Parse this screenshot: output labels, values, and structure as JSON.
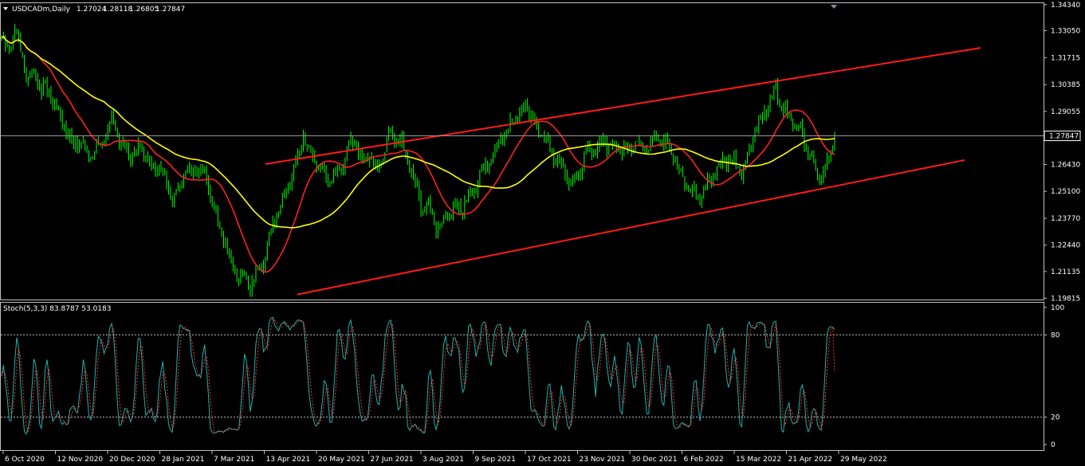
{
  "symbol_header": "USDCADm,Daily",
  "ohlc": {
    "open": "1.27024",
    "high": "1.28118",
    "low": "1.26805",
    "close": "1.27847"
  },
  "indicator_header": "Stoch(5,3,3) 83.8787 53.0183",
  "current_price": "1.27847",
  "chart_data": {
    "type": "candlestick",
    "price_ticks": [
      "1.34340",
      "1.33050",
      "1.31715",
      "1.30385",
      "1.29055",
      "1.27847",
      "1.26430",
      "1.25100",
      "1.23770",
      "1.22440",
      "1.21135",
      "1.19815"
    ],
    "ylim": [
      1.1975,
      1.3445
    ],
    "date_labels": [
      "6 Oct 2020",
      "12 Nov 2020",
      "20 Dec 2020",
      "28 Jan 2021",
      "7 Mar 2021",
      "13 Apr 2021",
      "20 May 2021",
      "27 Jun 2021",
      "3 Aug 2021",
      "9 Sep 2021",
      "17 Oct 2021",
      "23 Nov 2021",
      "30 Dec 2021",
      "6 Feb 2022",
      "15 Mar 2022",
      "21 Apr 2022",
      "29 May 2022"
    ],
    "price_anchors": [
      [
        1.327,
        1.3215,
        1.3305,
        1.32,
        1.306,
        1.311,
        1.301,
        1.302,
        1.294,
        1.287,
        1.28,
        1.274,
        1.277,
        1.268,
        1.27,
        1.274,
        1.282
      ],
      [
        1.286,
        1.276,
        1.271,
        1.269,
        1.273,
        1.267,
        1.261,
        1.265,
        1.256,
        1.247,
        1.252,
        1.261,
        1.259,
        1.264,
        1.259,
        1.248,
        1.236
      ],
      [
        1.226,
        1.215,
        1.21,
        1.208,
        1.206,
        1.211,
        1.217,
        1.23,
        1.24,
        1.248,
        1.259,
        1.266,
        1.278,
        1.27,
        1.264,
        1.26,
        1.256
      ],
      [
        1.258,
        1.264,
        1.274,
        1.276,
        1.264,
        1.27,
        1.262,
        1.268,
        1.278,
        1.279,
        1.274,
        1.266,
        1.256,
        1.243,
        1.245,
        1.236,
        1.233
      ],
      [
        1.24,
        1.244,
        1.242,
        1.248,
        1.251,
        1.258,
        1.264,
        1.269,
        1.277,
        1.28,
        1.286,
        1.29,
        1.293,
        1.286,
        1.28,
        1.276,
        1.27
      ],
      [
        1.264,
        1.259,
        1.254,
        1.261,
        1.269,
        1.272,
        1.274,
        1.276,
        1.274,
        1.273,
        1.274,
        1.272,
        1.276,
        1.27,
        1.275,
        1.278,
        1.276
      ],
      [
        1.271,
        1.265,
        1.256,
        1.252,
        1.248,
        1.252,
        1.258,
        1.262,
        1.265,
        1.266,
        1.264,
        1.26,
        1.272,
        1.282,
        1.288,
        1.296,
        1.303
      ],
      [
        1.292,
        1.288,
        1.283,
        1.279,
        1.27,
        1.262,
        1.257,
        1.265,
        1.2785
      ]
    ],
    "moving_averages": [
      {
        "color": "#ff2020",
        "period": 21
      },
      {
        "color": "#ffff00",
        "period": 55
      }
    ],
    "trend_lines": [
      {
        "color": "#ff1a1a",
        "from": [
          "13 Apr 2021",
          1.2645
        ],
        "to": [
          "21 Jun 2022",
          1.322
        ]
      },
      {
        "color": "#ff1a1a",
        "from": [
          "20 May 2021",
          1.2
        ],
        "to": [
          "20 Jun 2022",
          1.2665
        ]
      }
    ],
    "stochastic": {
      "k": 5,
      "d": 3,
      "slowing": 3,
      "k_value": 83.8787,
      "d_value": 53.0183,
      "ticks": [
        "100",
        "80",
        "20",
        "0"
      ],
      "levels": [
        80,
        20
      ],
      "colors": {
        "main": "#20b2aa",
        "signal": "#ff3030"
      }
    }
  },
  "colors": {
    "background": "#000000",
    "foreground": "#ffffff",
    "bull_candle": "#00ff00",
    "grid_line": "#c0c0c0"
  }
}
